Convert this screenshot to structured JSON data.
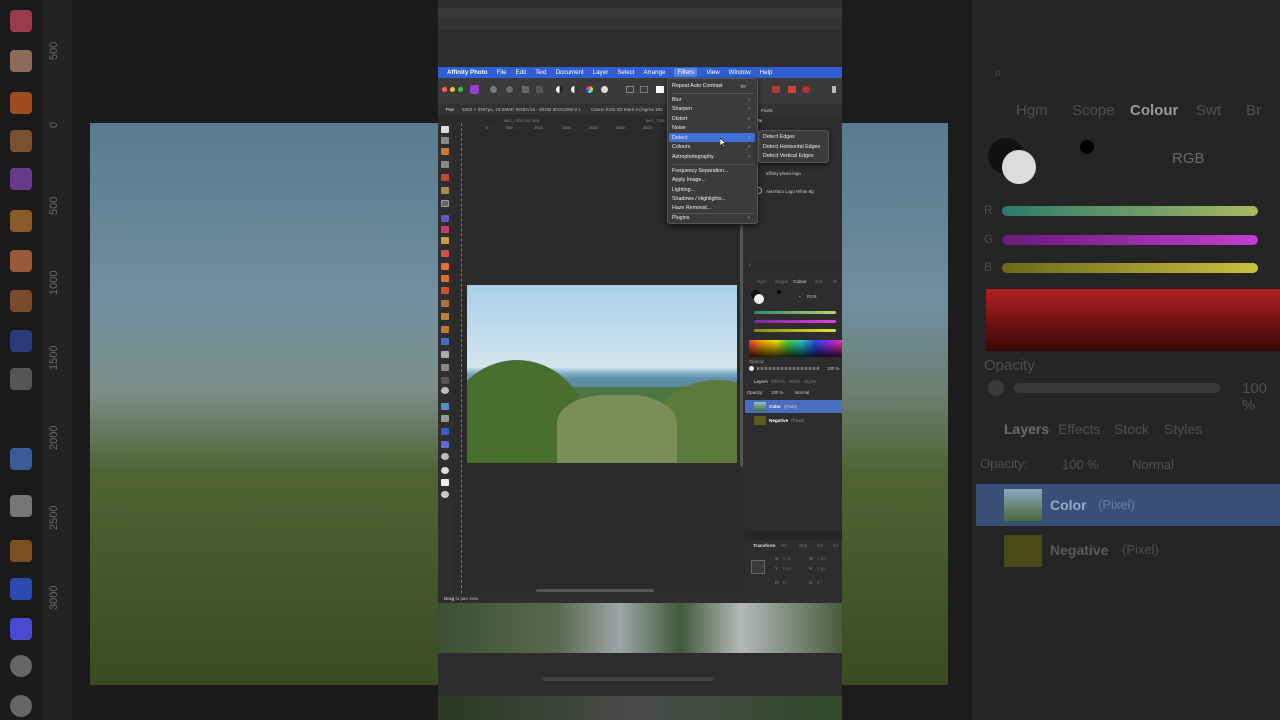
{
  "app": {
    "name": "Affinity Photo"
  },
  "menubar": {
    "items": [
      "File",
      "Edit",
      "Text",
      "Document",
      "Layer",
      "Select",
      "Arrange",
      "Filters",
      "View",
      "Window",
      "Help"
    ],
    "active": "Filters"
  },
  "context_bar": {
    "tool": "Pan",
    "doc_info": "5483 × 3597px, 19.69MP, RGBA/16 - sRGB IEC61966-2.1",
    "camera": "Canon EOS 5D Mark II (Sigma 100"
  },
  "doc_tabs": {
    "left": "IMG_7328.CR2 (M)",
    "right": "IMG_7328"
  },
  "filters_menu": {
    "repeat": "Repeat Auto Contrast",
    "repeat_shortcut": "⌘F",
    "items_a": [
      "Blur",
      "Sharpen",
      "Distort",
      "Noise",
      "Detect",
      "Colours",
      "Astrophotography"
    ],
    "highlighted": "Detect",
    "items_b": [
      "Frequency Separation...",
      "Apply Image...",
      "Lighting...",
      "Shadows / Highlights...",
      "Haze Removal..."
    ],
    "plugins": "Plugins"
  },
  "detect_submenu": {
    "items": [
      "Detect Edges",
      "Detect Horizontal Edges",
      "Detect Vertical Edges"
    ]
  },
  "right_panel": {
    "top_labels": {
      "pixels": "Pixels",
      "assets": "ssets"
    },
    "assets": [
      "affinity-photo-logo",
      "AlexTaca Logo White Bg"
    ],
    "color_tabs": [
      "Hgm",
      "Scope",
      "Colour",
      "Swt",
      "Br"
    ],
    "active_color_tab": "Colour",
    "color_model": "RGB",
    "opacity_label": "Opacity",
    "opacity_value": "100 %",
    "layer_tabs": [
      "Layers",
      "Effects",
      "Stock",
      "Styles"
    ],
    "active_layer_tab": "Layers",
    "layer_opacity_label": "Opacity:",
    "layer_opacity": "100 %",
    "blend_mode": "Normal",
    "layers": [
      {
        "name": "Color",
        "type": "(Pixel)",
        "selected": true
      },
      {
        "name": "Negative",
        "type": "(Pixel)",
        "selected": false
      }
    ],
    "transform_tabs": [
      "Transform",
      "Hs",
      "Snp",
      "Clr",
      "Inf"
    ],
    "transform_fields": [
      "X:",
      "Y:",
      "W:",
      "H:",
      "R:",
      "S:"
    ],
    "transform_values": [
      "0 px",
      "0 px",
      "0 px",
      "0 px",
      "0 °",
      "0 °"
    ]
  },
  "status": {
    "bold": "Drag",
    "text": "to pan view."
  },
  "bg_right": {
    "tabs": [
      "Hgm",
      "Scope",
      "Colour",
      "Swt",
      "Br"
    ],
    "model": "RGB",
    "channels": [
      "R",
      "G",
      "B"
    ],
    "opacity_label": "Opacity",
    "opacity_value": "100 %",
    "layer_tabs": [
      "Layers",
      "Effects",
      "Stock",
      "Styles"
    ],
    "layer_opacity_label": "Opacity:",
    "layer_opacity": "100 %",
    "blend_mode": "Normal",
    "layers": [
      {
        "name": "Color",
        "type": "(Pixel)"
      },
      {
        "name": "Negative",
        "type": "(Pixel)"
      }
    ]
  },
  "bg_left": {
    "ruler_ticks": [
      "500",
      "0",
      "500",
      "1000",
      "1500",
      "2000",
      "2500",
      "3000"
    ]
  },
  "colors": {
    "menubar": "#2f5fd2",
    "highlight": "#3f6fd8",
    "panel": "#2d2d2d"
  }
}
